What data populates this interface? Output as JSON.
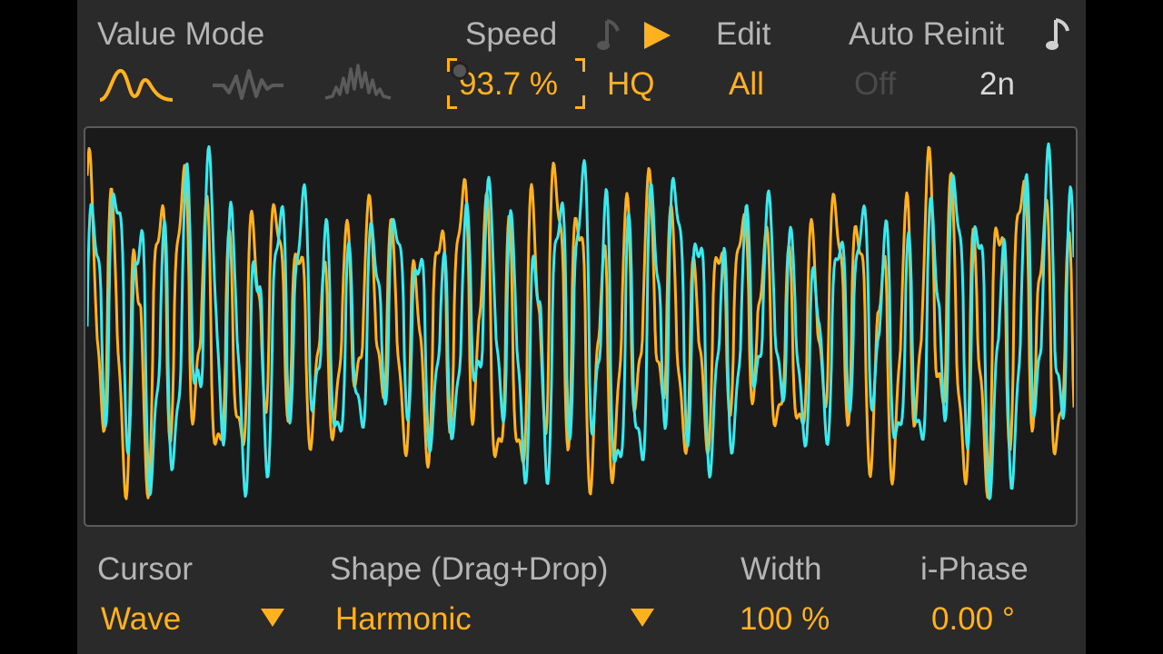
{
  "header": {
    "value_mode_label": "Value Mode",
    "speed_label": "Speed",
    "speed_value": "93.7 %",
    "hq_label": "HQ",
    "edit_label": "Edit",
    "edit_value": "All",
    "auto_reinit_label": "Auto Reinit",
    "auto_reinit_value": "Off",
    "sync_rate": "2n"
  },
  "value_modes": [
    {
      "name": "smooth",
      "selected": true
    },
    {
      "name": "wave",
      "selected": false
    },
    {
      "name": "noise",
      "selected": false
    }
  ],
  "waveform": {
    "series_colors": [
      "#ffb21e",
      "#39eaee"
    ]
  },
  "footer": {
    "cursor_label": "Cursor",
    "cursor_value": "Wave",
    "shape_label": "Shape (Drag+Drop)",
    "shape_value": "Harmonic",
    "width_label": "Width",
    "width_value": "100 %",
    "phase_label": "i-Phase",
    "phase_value": "0.00 °"
  },
  "colors": {
    "accent": "#ffb21e",
    "cyan": "#39eaee",
    "panel": "#2a2a2a",
    "label": "#b5b5b5"
  }
}
